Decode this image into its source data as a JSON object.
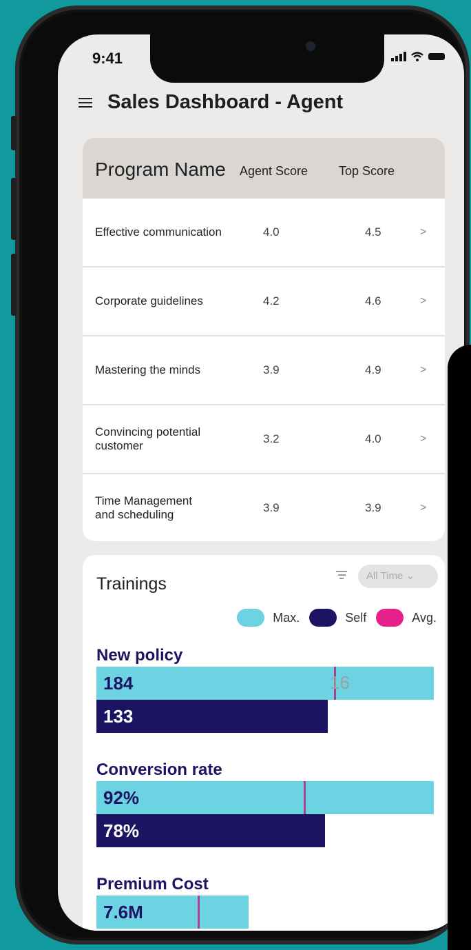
{
  "status": {
    "time": "9:41"
  },
  "header": {
    "title": "Sales Dashboard - Agent"
  },
  "program_table": {
    "columns": [
      "Program Name",
      "Agent Score",
      "Top Score"
    ],
    "rows": [
      {
        "name": "Effective communication",
        "agent": "4.0",
        "top": "4.5",
        "chev": ">"
      },
      {
        "name": "Corporate guidelines",
        "agent": "4.2",
        "top": "4.6",
        "chev": ">"
      },
      {
        "name": "Mastering the minds",
        "agent": "3.9",
        "top": "4.9",
        "chev": ">"
      },
      {
        "name": "Convincing potential customer",
        "agent": "3.2",
        "top": "4.0",
        "chev": ">"
      },
      {
        "name": "Time Management and scheduling",
        "agent": "3.9",
        "top": "3.9",
        "chev": ">"
      }
    ]
  },
  "trainings": {
    "title": "Trainings",
    "filter_value": "All Time ⌄",
    "legend": [
      {
        "label": "Max.",
        "color": "#6cd3e3"
      },
      {
        "label": "Self",
        "color": "#1c1463"
      },
      {
        "label": "Avg.",
        "color": "#e6228a"
      }
    ],
    "metrics": [
      {
        "label": "New policy",
        "max_label": "184",
        "self_label": "133",
        "avg_label": "16",
        "max_fraction": 1.0,
        "self_fraction": 0.685,
        "avg_fraction": 0.705
      },
      {
        "label": "Conversion rate",
        "max_label": "92%",
        "self_label": "78%",
        "avg_label": "",
        "max_fraction": 1.0,
        "self_fraction": 0.677,
        "avg_fraction": 0.615
      },
      {
        "label": "Premium Cost",
        "max_label": "7.6M",
        "self_label": "",
        "avg_label": "",
        "max_fraction": 0.45,
        "self_fraction": 0,
        "avg_fraction": 0.3
      }
    ]
  },
  "colors": {
    "background": "#119a9e",
    "max": "#6cd3e3",
    "self": "#1c1463",
    "avg_line": "#b03d8e"
  }
}
